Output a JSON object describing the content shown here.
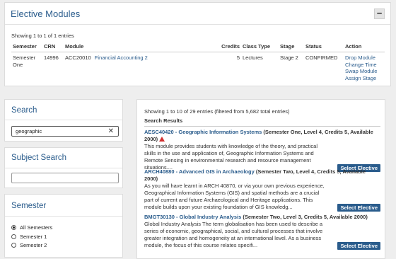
{
  "elective": {
    "title": "Elective Modules",
    "collapse_icon": "−",
    "showing": "Showing 1 to 1 of 1 entries",
    "columns": [
      "Semester",
      "CRN",
      "Module",
      "Credits",
      "Class Type",
      "Stage",
      "Status",
      "Action"
    ],
    "row": {
      "semester": "Semester One",
      "crn": "14996",
      "code": "ACC20010",
      "module_name": "Financial Accounting 2",
      "credits": "5",
      "class_type": "Lectures",
      "stage": "Stage 2",
      "status": "CONFIRMED",
      "actions": [
        "Drop Module",
        "Change Time",
        "Swap Module",
        "Assign Stage"
      ]
    }
  },
  "search": {
    "title": "Search",
    "value": "geographic",
    "clear_icon": "✕"
  },
  "subject_search": {
    "title": "Subject Search",
    "value": ""
  },
  "semester": {
    "title": "Semester",
    "options": [
      "All Semesters",
      "Semester 1",
      "Semester 2"
    ],
    "selected": "All Semesters"
  },
  "results": {
    "showing": "Showing 1 to 10 of 29 entries (filtered from 5,682 total entries)",
    "header": "Search Results",
    "select_label": "Select Elective",
    "items": [
      {
        "code_title": "AESC40420 - Geographic Information Systems",
        "meta": " (Semester One, Level 4, Credits 5, Available 2000)",
        "warning": true,
        "description": "This module provides students with knowledge of the theory, and practical skills in the use and application of, Geographic Information Systems and Remote Sensing in environmental research and resource management situations...."
      },
      {
        "code_title": "ARCH40880 - Advanced GIS in Archaeology",
        "meta": " (Semester Two, Level 4, Credits 5, Available 2000)",
        "warning": false,
        "description": "As you will have learnt in ARCH 40870, or via your own previous experience, Geographical Information Systems (GIS) and spatial methods are a crucial part of current and future Archaeological and Heritage applications. This module builds upon your existing foundation of GIS knowledg..."
      },
      {
        "code_title": "BMGT30130 - Global Industry Analysis",
        "meta": " (Semester Two, Level 3, Credits 5, Available 2000)",
        "warning": false,
        "description": "Global Industry Analysis The term globalisation has been used to describe a series of economic, geographical, social, and cultural processes that involve greater integration and homogeneity at an international level. As a business module, the focus of this course relates specifi..."
      }
    ]
  },
  "colors": {
    "accent": "#2a5c8c",
    "warning": "#d03030",
    "background": "#eeeeee"
  }
}
